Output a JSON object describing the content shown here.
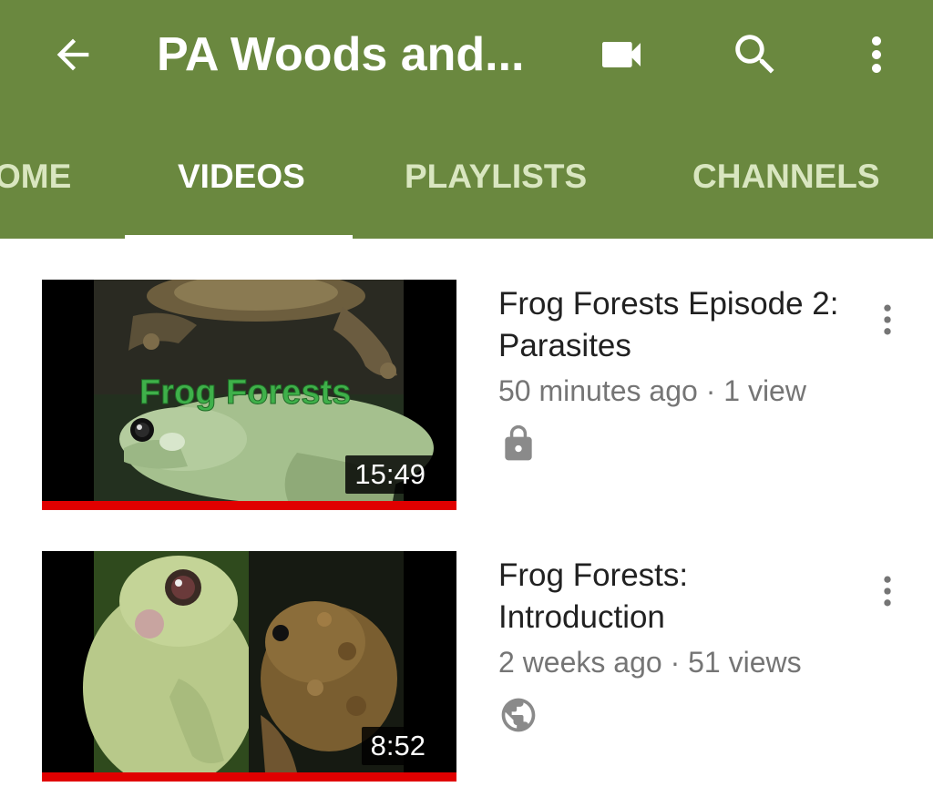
{
  "colors": {
    "app_bar": "#6a883f",
    "tab_inactive": "#d9e6c0",
    "progress": "#e00000"
  },
  "toolbar": {
    "back_icon": "arrow-back-icon",
    "title": "PA Woods and...",
    "camera_icon": "video-camera-icon",
    "search_icon": "search-icon",
    "more_icon": "more-vert-icon"
  },
  "tabs": [
    {
      "label": "OME",
      "active": false
    },
    {
      "label": "VIDEOS",
      "active": true
    },
    {
      "label": "PLAYLISTS",
      "active": false
    },
    {
      "label": "CHANNELS",
      "active": false
    }
  ],
  "videos": [
    {
      "title": "Frog Forests Episode 2: Parasites",
      "meta": "50 minutes ago · 1 view",
      "duration": "15:49",
      "thumbnail_text": "Frog Forests",
      "status_icon": "lock-icon",
      "watched_fraction": 1.0
    },
    {
      "title": "Frog Forests: Introduction",
      "meta": "2 weeks ago · 51 views",
      "duration": "8:52",
      "status_icon": "globe-icon",
      "watched_fraction": 1.0
    }
  ]
}
